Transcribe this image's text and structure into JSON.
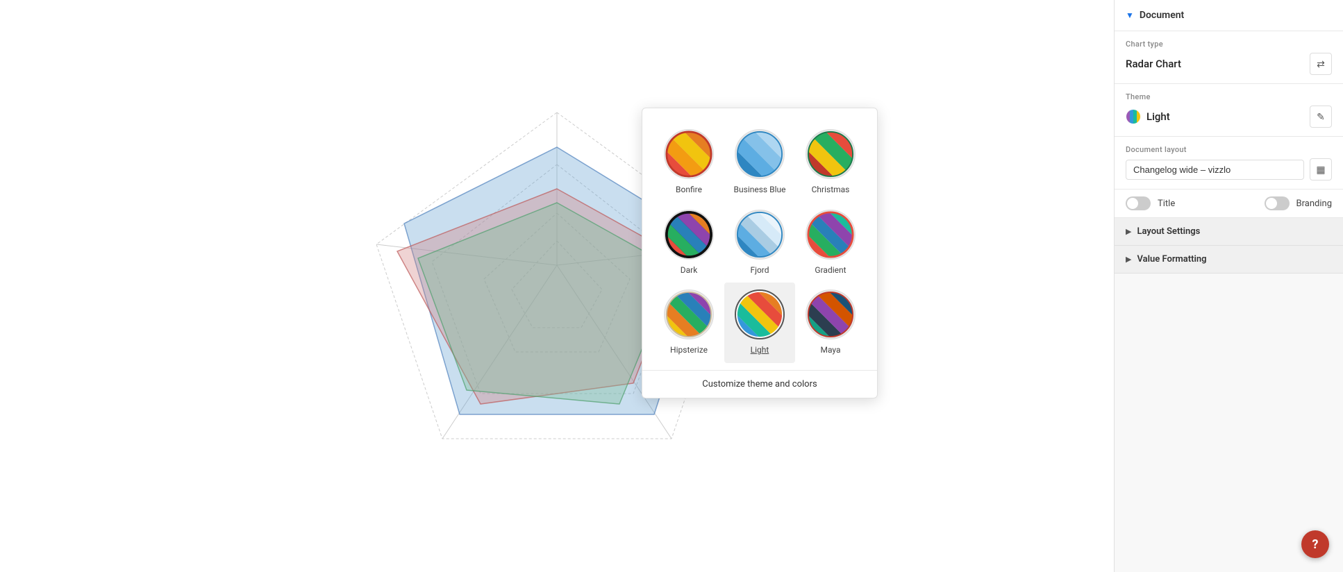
{
  "panel": {
    "document_label": "Document",
    "chart_type_label": "Chart type",
    "chart_type_value": "Radar Chart",
    "theme_label": "Theme",
    "theme_value": "Light",
    "document_layout_label": "Document layout",
    "document_layout_value": "Changelog wide – vizzlo",
    "title_label": "Title",
    "branding_label": "Branding",
    "layout_settings_label": "Layout Settings",
    "value_formatting_label": "Value Formatting"
  },
  "themes": [
    {
      "id": "bonfire",
      "name": "Bonfire",
      "selected": false
    },
    {
      "id": "business-blue",
      "name": "Business Blue",
      "selected": false
    },
    {
      "id": "christmas",
      "name": "Christmas",
      "selected": false
    },
    {
      "id": "dark",
      "name": "Dark",
      "selected": false
    },
    {
      "id": "fjord",
      "name": "Fjord",
      "selected": false
    },
    {
      "id": "gradient",
      "name": "Gradient",
      "selected": false
    },
    {
      "id": "hipsterize",
      "name": "Hipsterize",
      "selected": false
    },
    {
      "id": "light",
      "name": "Light",
      "selected": true
    },
    {
      "id": "maya",
      "name": "Maya",
      "selected": false
    }
  ],
  "customize_link": "Customize theme and colors",
  "help_label": "?",
  "icons": {
    "chevron_down": "▼",
    "chevron_right": "▶",
    "swap": "⇄",
    "edit": "✎",
    "grid": "▦",
    "collapse": "❮"
  }
}
